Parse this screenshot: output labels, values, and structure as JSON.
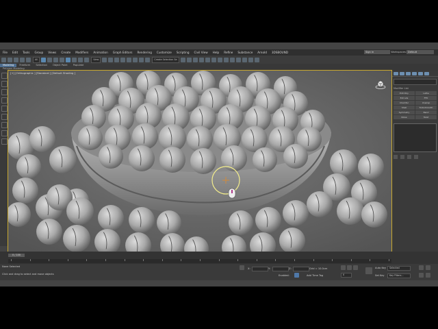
{
  "menubar": {
    "items": [
      "File",
      "Edit",
      "Tools",
      "Group",
      "Views",
      "Create",
      "Modifiers",
      "Animation",
      "Graph Editors",
      "Rendering",
      "Customize",
      "Scripting",
      "Civil View",
      "Help",
      "Refine",
      "Substance",
      "Arnold",
      "3DSBOUND"
    ],
    "sign_in": "Sign in",
    "workspaces_label": "Workspaces:",
    "workspace_value": "Default"
  },
  "toolbar": {
    "filter_value": "All",
    "view_value": "View",
    "selection_set": "Create Selection Se"
  },
  "ribbon": {
    "tabs": [
      "Modeling",
      "Freeform",
      "Selection",
      "Object Paint",
      "Populate"
    ],
    "subtitle": "Polygon Modeling"
  },
  "viewport": {
    "label": "[+] [Orthographic ] [Standard ] [Default Shading ]"
  },
  "command_panel": {
    "modifier_list": "Modifier List",
    "buttons": [
      "Edit Poly",
      "Lathe",
      "Extrude",
      "FFD",
      "Chamfer",
      "Unwrap",
      "Shell",
      "TurboSmooth",
      "Symmetry",
      "Bend",
      "Noise",
      "Twist"
    ]
  },
  "timeline": {
    "slider": "0 / 100",
    "ticks": [
      "0",
      "5",
      "10",
      "15",
      "20",
      "25",
      "30",
      "35",
      "40",
      "45",
      "50",
      "55",
      "60",
      "65",
      "70",
      "75",
      "80",
      "85",
      "90",
      "95",
      "100"
    ]
  },
  "statusbar": {
    "selection": "None Selected",
    "prompt": "Click and drag to select and move objects",
    "x_label": "X:",
    "y_label": "Y:",
    "z_label": "Z:",
    "grid": "Grid = 10.0cm",
    "enabled": "Enabled:",
    "add_time_tag": "Add Time Tag",
    "auto_key": "Auto Key",
    "set_key": "Set Key",
    "selected": "Selected",
    "key_filters": "Key Filters...",
    "frame": "0"
  }
}
